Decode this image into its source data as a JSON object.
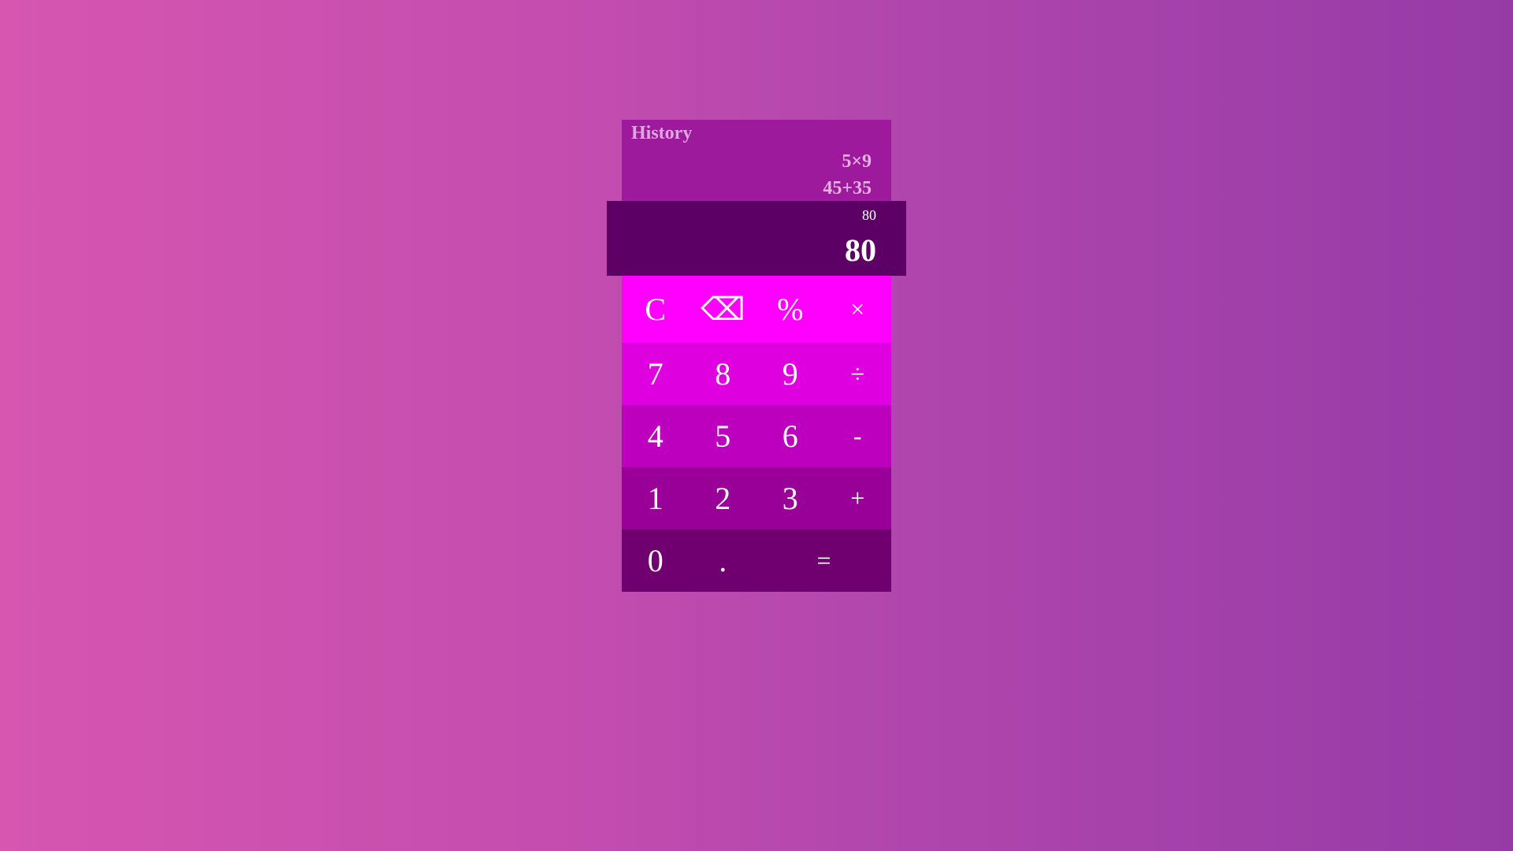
{
  "history": {
    "title": "History",
    "items": [
      "5×9",
      "45+35"
    ]
  },
  "display": {
    "previous": "80",
    "current": "80"
  },
  "keys": {
    "clear": "C",
    "backspace": "⌫",
    "percent": "%",
    "multiply": "×",
    "seven": "7",
    "eight": "8",
    "nine": "9",
    "divide": "÷",
    "four": "4",
    "five": "5",
    "six": "6",
    "minus": "-",
    "one": "1",
    "two": "2",
    "three": "3",
    "plus": "+",
    "zero": "0",
    "decimal": ".",
    "equals": "="
  },
  "colors": {
    "history_bg": "#9e1a9c",
    "display_bg": "#5c0066",
    "row1": "#ff00ff",
    "row2": "#de00de",
    "row3": "#bd00bd",
    "row4": "#980098",
    "row5": "#700070"
  }
}
